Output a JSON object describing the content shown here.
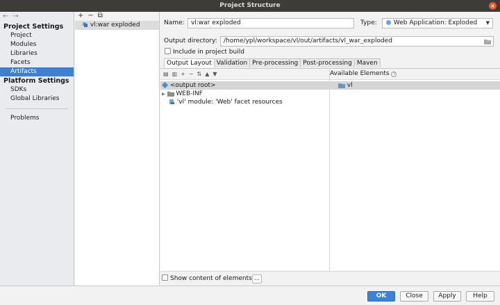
{
  "window": {
    "title": "Project Structure"
  },
  "sidebar": {
    "project_settings": "Project Settings",
    "project_items": [
      {
        "label": "Project"
      },
      {
        "label": "Modules"
      },
      {
        "label": "Libraries"
      },
      {
        "label": "Facets"
      },
      {
        "label": "Artifacts",
        "selected": true
      }
    ],
    "platform_settings": "Platform Settings",
    "platform_items": [
      {
        "label": "SDKs"
      },
      {
        "label": "Global Libraries"
      }
    ],
    "problems": "Problems"
  },
  "artifacts": {
    "toolbar": {
      "add": "+",
      "remove": "−",
      "copy": "⧉"
    },
    "items": [
      {
        "label": "vl:war exploded"
      }
    ]
  },
  "editor": {
    "name_label": "Name:",
    "name_value": "vl:war exploded",
    "type_label": "Type:",
    "type_value": "Web Application: Exploded",
    "output_dir_label": "Output directory:",
    "output_dir_value": "/home/ypl/workspace/vl/out/artifacts/vl_war_exploded",
    "include_build_label": "Include in project build",
    "tabs": [
      {
        "label": "Output Layout",
        "active": true
      },
      {
        "label": "Validation"
      },
      {
        "label": "Pre-processing"
      },
      {
        "label": "Post-processing"
      },
      {
        "label": "Maven"
      }
    ],
    "available_elements_label": "Available Elements",
    "tree": [
      {
        "label": "<output root>"
      },
      {
        "label": "WEB-INF"
      },
      {
        "label": "'vl' module: 'Web' facet resources"
      }
    ],
    "available": [
      {
        "label": "vl"
      }
    ],
    "show_content_label": "Show content of elements",
    "dots": "..."
  },
  "footer": {
    "ok": "OK",
    "close": "Close",
    "apply": "Apply",
    "help": "Help"
  },
  "colors": {
    "accent": "#3d7fd0",
    "titlebar": "#3d3c38",
    "close": "#e45a26"
  }
}
